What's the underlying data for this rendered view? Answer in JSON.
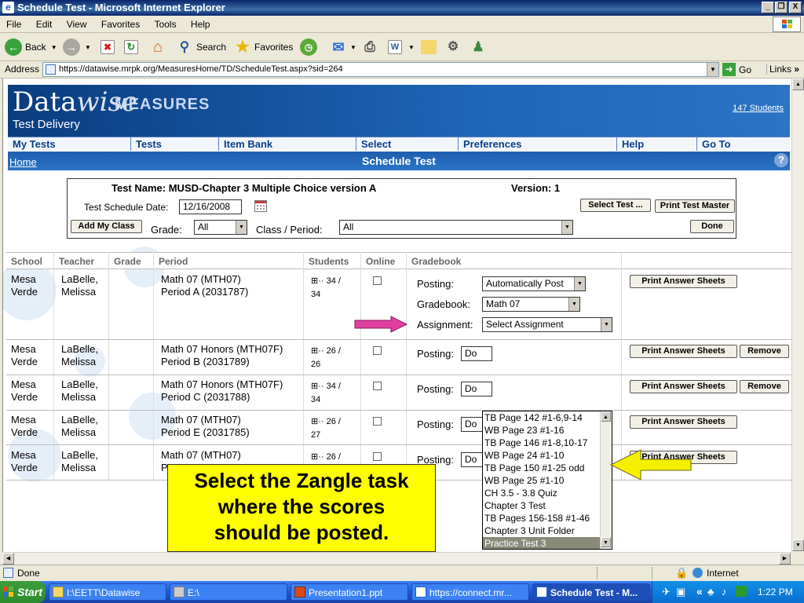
{
  "window": {
    "title": "Schedule Test - Microsoft Internet Explorer",
    "buttons": [
      "_",
      "❐",
      "X"
    ]
  },
  "menu": [
    "File",
    "Edit",
    "View",
    "Favorites",
    "Tools",
    "Help"
  ],
  "toolbar": {
    "back": "Back",
    "search": "Search",
    "favorites": "Favorites"
  },
  "address": {
    "label": "Address",
    "url": "https://datawise.mrpk.org/MeasuresHome/TD/ScheduleTest.aspx?sid=264",
    "go": "Go",
    "links": "Links"
  },
  "banner": {
    "logo_data": "Data",
    "logo_wise": "wise",
    "logo_measures": "MEASURES",
    "subtitle": "Test Delivery",
    "students_link": "147 Students"
  },
  "nav": [
    "My Tests",
    "Tests",
    "Item Bank",
    "Select",
    "Preferences",
    "Help",
    "Go To"
  ],
  "subnav": {
    "home": "Home",
    "title": "Schedule Test",
    "help": "?"
  },
  "test": {
    "name_label": "Test Name: MUSD-Chapter 3 Multiple Choice version A",
    "version_label": "Version: 1",
    "schedule_date_label": "Test Schedule Date:",
    "schedule_date": "12/16/2008",
    "select_test": "Select Test ...",
    "print_master": "Print Test Master",
    "add_class": "Add My Class",
    "grade_label": "Grade:",
    "grade_value": "All",
    "period_label": "Class / Period:",
    "period_value": "All",
    "done": "Done"
  },
  "table": {
    "headers": [
      "School",
      "Teacher",
      "Grade",
      "Period",
      "Students",
      "Online",
      "Gradebook"
    ],
    "rows": [
      {
        "school1": "Mesa",
        "school2": "Verde",
        "teacher1": "LaBelle,",
        "teacher2": "Melissa",
        "period1": "Math 07 (MTH07)",
        "period2": "Period A (2031787)",
        "students1": "34 /",
        "students2": "34"
      },
      {
        "school1": "Mesa",
        "school2": "Verde",
        "teacher1": "LaBelle,",
        "teacher2": "Melissa",
        "period1": "Math 07 Honors (MTH07F)",
        "period2": "Period B (2031789)",
        "students1": "26 /",
        "students2": "26"
      },
      {
        "school1": "Mesa",
        "school2": "Verde",
        "teacher1": "LaBelle,",
        "teacher2": "Melissa",
        "period1": "Math 07 Honors (MTH07F)",
        "period2": "Period C (2031788)",
        "students1": "34 /",
        "students2": "34"
      },
      {
        "school1": "Mesa",
        "school2": "Verde",
        "teacher1": "LaBelle,",
        "teacher2": "Melissa",
        "period1": "Math 07 (MTH07)",
        "period2": "Period E (2031785)",
        "students1": "26 /",
        "students2": "27"
      },
      {
        "school1": "Mesa",
        "school2": "Verde",
        "teacher1": "LaBelle,",
        "teacher2": "Melissa",
        "period1": "Math 07 (MTH07)",
        "period2": "Pe",
        "students1": "26 /",
        "students2": ""
      }
    ],
    "gradebook": {
      "posting_label": "Posting:",
      "posting_value": "Automatically Post",
      "gradebook_label": "Gradebook:",
      "gradebook_value": "Math 07",
      "assignment_label": "Assignment:",
      "assignment_value": "Select Assignment",
      "posting_short": "Do"
    },
    "print_answer_sheets": "Print Answer Sheets",
    "remove": "Remove"
  },
  "assignment_options": [
    "TB Page 142 #1-6,9-14",
    "WB Page 23 #1-16",
    "TB Page 146 #1-8,10-17",
    "WB Page 24 #1-10",
    "TB Page 150 #1-25 odd",
    "WB Page 25 #1-10",
    "CH 3.5 - 3.8 Quiz",
    "Chapter 3 Test",
    "TB Pages 156-158 #1-46",
    "Chapter 3 Unit Folder",
    "Practice Test 3"
  ],
  "callout": {
    "line1": "Select the Zangle task",
    "line2": "where the scores",
    "line3": "should be posted."
  },
  "status": {
    "text": "Done",
    "zone": "Internet"
  },
  "taskbar": {
    "start": "Start",
    "tasks": [
      "I:\\EETT\\Datawise",
      "E:\\",
      "Presentation1.ppt",
      "https://connect.mr...",
      "Schedule Test - M..."
    ],
    "clock": "1:22 PM"
  },
  "colors": {
    "banner": "#1E66B8",
    "callout": "#FFFF00",
    "pink_arrow": "#E040A0",
    "yellow_arrow": "#F5F000"
  }
}
